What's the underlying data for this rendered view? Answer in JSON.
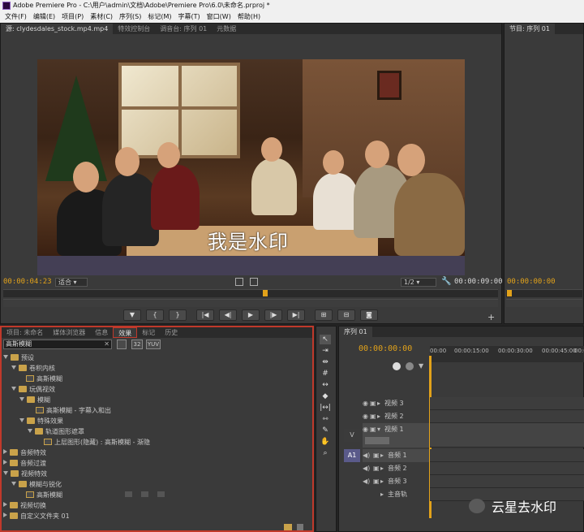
{
  "title_bar": {
    "text": "Adobe Premiere Pro - C:\\用户\\admin\\文档\\Adobe\\Premiere Pro\\6.0\\未命名.prproj *"
  },
  "menu": [
    "文件(F)",
    "编辑(E)",
    "项目(P)",
    "素材(C)",
    "序列(S)",
    "标记(M)",
    "字幕(T)",
    "窗口(W)",
    "帮助(H)"
  ],
  "source_monitor": {
    "tabs": [
      "源: clydesdales_stock.mp4.mp4",
      "特效控制台",
      "调音台: 序列 01",
      "元数据"
    ],
    "watermark_text": "我是水印",
    "current_time": "00:00:04:23",
    "fit_label": "适合",
    "resolution": "1/2",
    "duration": "00:00:09:00"
  },
  "program_monitor": {
    "tabs": [
      "节目: 序列 01"
    ],
    "current_time": "00:00:00:00"
  },
  "effects_panel": {
    "tabs": [
      "项目: 未命名",
      "媒体浏览器",
      "信息",
      "效果",
      "标记",
      "历史"
    ],
    "search_value": "高斯模糊",
    "search_badges": [
      "32",
      "YUV"
    ],
    "tree": [
      {
        "label": "预设",
        "level": 0,
        "kind": "folder",
        "open": true
      },
      {
        "label": "卷积内核",
        "level": 1,
        "kind": "folder",
        "open": true
      },
      {
        "label": "高斯模糊",
        "level": 2,
        "kind": "fx"
      },
      {
        "label": "玩偶视效",
        "level": 1,
        "kind": "folder",
        "open": true
      },
      {
        "label": "模糊",
        "level": 2,
        "kind": "folder",
        "open": true
      },
      {
        "label": "高斯模糊 - 字幕入和出",
        "level": 3,
        "kind": "fx"
      },
      {
        "label": "特殊效果",
        "level": 2,
        "kind": "folder",
        "open": true
      },
      {
        "label": "轨道图形遮罩",
        "level": 3,
        "kind": "folder",
        "open": true
      },
      {
        "label": "上层图形(隐藏) : 高斯模糊 - 渐隐",
        "level": 4,
        "kind": "fx"
      },
      {
        "label": "音频特效",
        "level": 0,
        "kind": "folder",
        "open": false
      },
      {
        "label": "音频过渡",
        "level": 0,
        "kind": "folder",
        "open": false
      },
      {
        "label": "视频特效",
        "level": 0,
        "kind": "folder",
        "open": true
      },
      {
        "label": "模糊与锐化",
        "level": 1,
        "kind": "folder",
        "open": true
      },
      {
        "label": "高斯模糊",
        "level": 2,
        "kind": "fx"
      },
      {
        "label": "视频切换",
        "level": 0,
        "kind": "folder",
        "open": false
      },
      {
        "label": "自定义文件夹 01",
        "level": 0,
        "kind": "folder",
        "open": false
      }
    ]
  },
  "timeline": {
    "tab": "序列 01",
    "current_time": "00:00:00:00",
    "ruler_labels": [
      "00:00",
      "00:00:15:00",
      "00:00:30:00",
      "00:00:45:00",
      "00:0"
    ],
    "video_tracks": [
      "视频 3",
      "视频 2",
      "视频 1"
    ],
    "audio_tracks": [
      "音频 1",
      "音频 2",
      "音频 3"
    ],
    "master_track": "主音轨",
    "target_video": "V",
    "target_audio": "A1"
  },
  "overlay_watermark": "云星去水印",
  "colors": {
    "timecode": "#e2a21a",
    "effects_highlight": "#c0392b",
    "panel": "#3a3a3a"
  }
}
